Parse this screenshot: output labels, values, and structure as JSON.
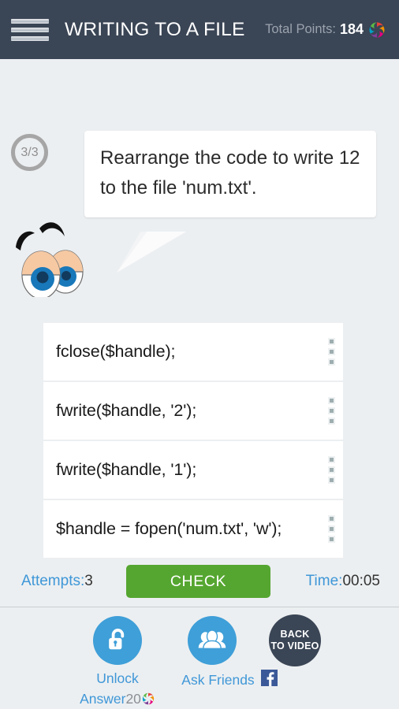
{
  "header": {
    "menu_icon": "hamburger-menu-icon",
    "title": "WRITING TO A FILE",
    "points_label": "Total Points:",
    "points_value": "184",
    "points_icon": "swirl-points-icon",
    "background_color": "#3a4555"
  },
  "question": {
    "progress": "3/3",
    "prompt": "Rearrange the code to write 12 to the file 'num.txt'.",
    "mascot_icon": "cartoon-eyes-mascot"
  },
  "code_blocks": [
    {
      "text": "fclose($handle);",
      "handle_icon": "drag-handle-icon"
    },
    {
      "text": "fwrite($handle, '2');",
      "handle_icon": "drag-handle-icon"
    },
    {
      "text": "fwrite($handle, '1');",
      "handle_icon": "drag-handle-icon"
    },
    {
      "text": "$handle = fopen('num.txt', 'w');",
      "handle_icon": "drag-handle-icon"
    }
  ],
  "action_bar": {
    "attempts_label": "Attempts:",
    "attempts_value": "3",
    "check_label": "CHECK",
    "check_color": "#55a630",
    "time_label": "Time:",
    "time_value": "00:05"
  },
  "bottom_actions": {
    "unlock": {
      "icon": "open-padlock-icon",
      "label_line1": "Unlock",
      "label_line2": "Answer",
      "cost": "20",
      "cost_icon": "swirl-points-icon",
      "color": "#3f9fd8"
    },
    "ask_friends": {
      "icon": "people-group-icon",
      "label": "Ask Friends",
      "share_icon": "facebook-icon",
      "color": "#3f9fd8"
    },
    "back_to_video": {
      "label_line1": "BACK",
      "label_line2": "TO VIDEO",
      "color": "#3a4555"
    }
  },
  "colors": {
    "page_background": "#eceff1",
    "link_blue": "#3f97d8",
    "card_white": "#ffffff"
  }
}
